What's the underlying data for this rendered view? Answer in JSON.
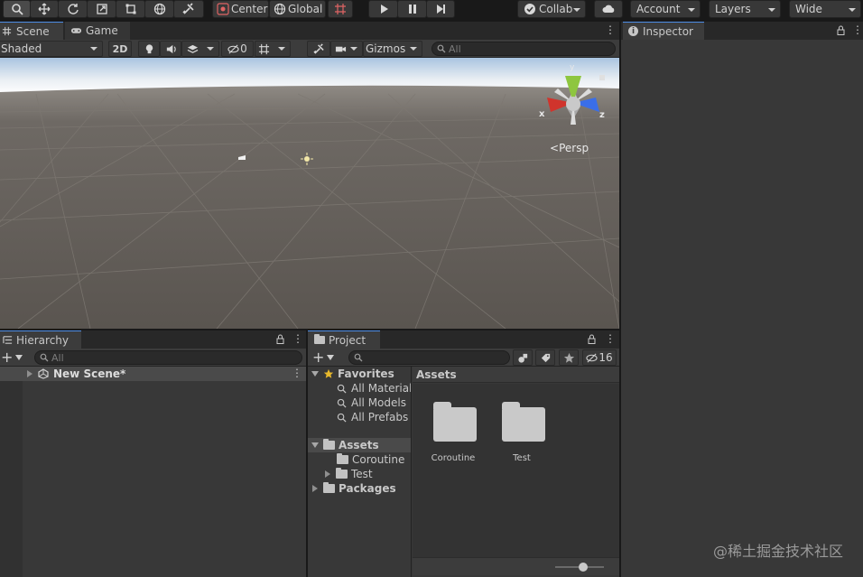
{
  "toolbar": {
    "center_label": "Center",
    "global_label": "Global",
    "collab_label": "Collab",
    "account_label": "Account",
    "layers_label": "Layers",
    "layout_label": "Wide"
  },
  "scene": {
    "tab_scene": "Scene",
    "tab_game": "Game",
    "shading_mode": "Shaded",
    "btn_2d": "2D",
    "hidden_count": "0",
    "gizmos_label": "Gizmos",
    "search_placeholder": "All",
    "persp_label": "Persp",
    "axis_x": "x",
    "axis_y": "y",
    "axis_z": "z"
  },
  "inspector": {
    "tab_label": "Inspector"
  },
  "hierarchy": {
    "tab_label": "Hierarchy",
    "search_placeholder": "All",
    "scene_name": "New Scene*"
  },
  "project": {
    "tab_label": "Project",
    "hidden_count": "16",
    "favorites_label": "Favorites",
    "favorites": [
      "All Materials",
      "All Models",
      "All Prefabs"
    ],
    "assets_label": "Assets",
    "assets_children": [
      "Coroutine",
      "Test"
    ],
    "packages_label": "Packages",
    "breadcrumb": "Assets",
    "grid_items": [
      "Coroutine",
      "Test"
    ]
  },
  "watermark": "@稀土掘金技术社区",
  "colors": {
    "accent_tab": "#4d8de6",
    "panel_bg": "#383838",
    "toolbar_bg": "#191919",
    "axis_x": "#d0342c",
    "axis_y": "#8ec63f",
    "axis_z": "#3a6ee8"
  }
}
